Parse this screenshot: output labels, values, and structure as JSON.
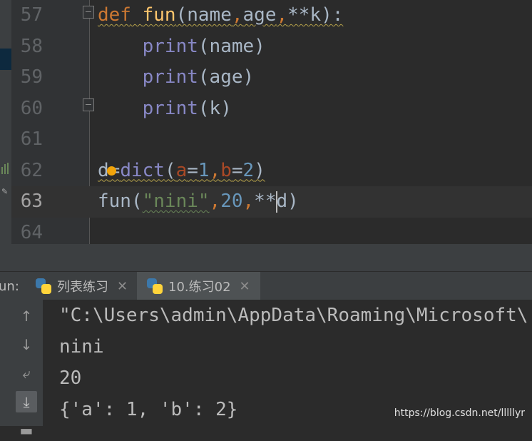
{
  "editor": {
    "lines": [
      {
        "num": "57",
        "parts": [
          [
            "def",
            "kw"
          ],
          [
            " ",
            ""
          ],
          [
            "fun",
            "fn"
          ],
          [
            "(name",
            ""
          ],
          [
            ",",
            "kw"
          ],
          [
            "age",
            ""
          ],
          [
            ",",
            "kw"
          ],
          [
            "**k):",
            ""
          ]
        ]
      },
      {
        "num": "58",
        "parts": [
          [
            "    ",
            ""
          ],
          [
            "print",
            "bi"
          ],
          [
            "(name)",
            ""
          ]
        ]
      },
      {
        "num": "59",
        "parts": [
          [
            "    ",
            ""
          ],
          [
            "print",
            "bi"
          ],
          [
            "(age)",
            ""
          ]
        ]
      },
      {
        "num": "60",
        "parts": [
          [
            "    ",
            ""
          ],
          [
            "print",
            "bi"
          ],
          [
            "(k)",
            ""
          ]
        ]
      },
      {
        "num": "61",
        "parts": []
      },
      {
        "num": "62",
        "parts": [
          [
            "d",
            ""
          ],
          [
            "=",
            ""
          ],
          [
            "dict",
            "bi"
          ],
          [
            "(",
            ""
          ],
          [
            "a",
            "param"
          ],
          [
            "=",
            ""
          ],
          [
            "1",
            "num"
          ],
          [
            ",",
            "kw"
          ],
          [
            "b",
            "param"
          ],
          [
            "=",
            ""
          ],
          [
            "2",
            "num"
          ],
          [
            ")",
            ""
          ]
        ]
      },
      {
        "num": "63",
        "parts": [
          [
            "fun(",
            ""
          ],
          [
            "\"nini\"",
            "str"
          ],
          [
            ",",
            "kw"
          ],
          [
            "20",
            "num"
          ],
          [
            ",",
            "kw"
          ],
          [
            "**",
            ""
          ],
          [
            "|",
            "caret"
          ],
          [
            "d)",
            ""
          ]
        ]
      },
      {
        "num": "64",
        "parts": []
      }
    ],
    "current_line": "63"
  },
  "run": {
    "label": "un:",
    "tabs": [
      {
        "label": "列表练习",
        "close": "✕",
        "active": false
      },
      {
        "label": "10.练习02",
        "close": "✕",
        "active": true
      }
    ]
  },
  "console": {
    "lines": [
      "\"C:\\Users\\admin\\AppData\\Roaming\\Microsoft\\",
      "nini",
      "20",
      "{'a': 1, 'b': 2}"
    ],
    "toolbar": [
      {
        "icon": "up-arrow-icon",
        "glyph": "↑"
      },
      {
        "icon": "down-arrow-icon",
        "glyph": "↓"
      },
      {
        "icon": "soft-wrap-icon",
        "glyph": "⤶"
      },
      {
        "icon": "scroll-to-end-icon",
        "glyph": "⤓"
      },
      {
        "icon": "print-icon",
        "glyph": "▬"
      }
    ]
  },
  "watermark": "https://blog.csdn.net/lllllyr",
  "colors": {
    "background": "#2b2b2b",
    "keyword": "#cc7832",
    "function": "#ffc66d",
    "builtin": "#8888c6",
    "number": "#6897bb",
    "string": "#6a8759"
  }
}
